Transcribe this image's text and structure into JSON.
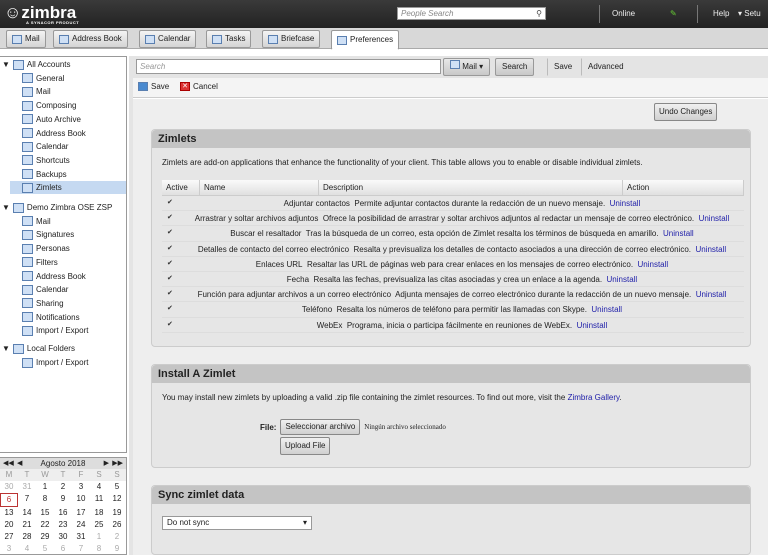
{
  "header": {
    "logo": "zimbra",
    "logo_sub": "A SYNACOR PRODUCT",
    "people_search_placeholder": "People Search",
    "status": "Online",
    "help": "Help",
    "setup": "▾ Setu"
  },
  "app_tabs": [
    {
      "label": "Mail",
      "icon": "mail-icon"
    },
    {
      "label": "Address Book",
      "icon": "contact-icon"
    },
    {
      "label": "Calendar",
      "icon": "calendar-icon"
    },
    {
      "label": "Tasks",
      "icon": "tasks-icon"
    },
    {
      "label": "Briefcase",
      "icon": "briefcase-icon"
    },
    {
      "label": "Preferences",
      "icon": "gear-icon",
      "active": true
    }
  ],
  "sidebar": {
    "all_accounts": "All Accounts",
    "items": [
      "General",
      "Mail",
      "Composing",
      "Auto Archive",
      "Address Book",
      "Calendar",
      "Shortcuts",
      "Backups",
      "Zimlets"
    ],
    "selected": "Zimlets",
    "demo_account": "Demo Zimbra OSE ZSP",
    "demo_items": [
      "Mail",
      "Signatures",
      "Personas",
      "Filters",
      "Address Book",
      "Calendar",
      "Sharing",
      "Notifications",
      "Import / Export"
    ],
    "local_folders": "Local Folders",
    "local_items": [
      "Import / Export"
    ]
  },
  "calendar": {
    "month": "Agosto 2018",
    "dow": [
      "M",
      "T",
      "W",
      "T",
      "F",
      "S",
      "S"
    ],
    "weeks": [
      [
        "30",
        "31",
        "1",
        "2",
        "3",
        "4",
        "5"
      ],
      [
        "6",
        "7",
        "8",
        "9",
        "10",
        "11",
        "12"
      ],
      [
        "13",
        "14",
        "15",
        "16",
        "17",
        "18",
        "19"
      ],
      [
        "20",
        "21",
        "22",
        "23",
        "24",
        "25",
        "26"
      ],
      [
        "27",
        "28",
        "29",
        "30",
        "31",
        "1",
        "2"
      ],
      [
        "3",
        "4",
        "5",
        "6",
        "7",
        "8",
        "9"
      ]
    ],
    "today": "6"
  },
  "search": {
    "placeholder": "Search",
    "type": "Mail",
    "search": "Search",
    "save": "Save",
    "advanced": "Advanced"
  },
  "toolbar": {
    "save": "Save",
    "cancel": "Cancel",
    "undo": "Undo Changes"
  },
  "zimlets": {
    "title": "Zimlets",
    "intro": "Zimlets are add-on applications that enhance the functionality of your client. This table allows you to enable or disable individual zimlets.",
    "columns": [
      "Active",
      "Name",
      "Description",
      "Action"
    ],
    "rows": [
      {
        "name": "Adjuntar contactos",
        "desc": "Permite adjuntar contactos durante la redacción de un nuevo mensaje.",
        "action": "Uninstall"
      },
      {
        "name": "Arrastrar y soltar archivos adjuntos",
        "desc": "Ofrece la posibilidad de arrastrar y soltar archivos adjuntos al redactar un mensaje de correo electrónico.",
        "action": "Uninstall"
      },
      {
        "name": "Buscar el resaltador",
        "desc": "Tras la búsqueda de un correo, esta opción de Zimlet resalta los términos de búsqueda en amarillo.",
        "action": "Uninstall"
      },
      {
        "name": "Detalles de contacto del correo electrónico",
        "desc": "Resalta y previsualiza los detalles de contacto asociados a una dirección de correo electrónico.",
        "action": "Uninstall"
      },
      {
        "name": "Enlaces URL",
        "desc": "Resaltar las URL de páginas web para crear enlaces en los mensajes de correo electrónico.",
        "action": "Uninstall"
      },
      {
        "name": "Fecha",
        "desc": "Resalta las fechas, previsualiza las citas asociadas y crea un enlace a la agenda.",
        "action": "Uninstall"
      },
      {
        "name": "Función para adjuntar archivos a un correo electrónico",
        "desc": "Adjunta mensajes de correo electrónico durante la redacción de un nuevo mensaje.",
        "action": "Uninstall"
      },
      {
        "name": "Teléfono",
        "desc": "Resalta los números de teléfono para permitir las llamadas con Skype.",
        "action": "Uninstall"
      },
      {
        "name": "WebEx",
        "desc": "Programa, inicia o participa fácilmente en reuniones de WebEx.",
        "action": "Uninstall"
      }
    ]
  },
  "install": {
    "title": "Install A Zimlet",
    "text": "You may install new zimlets by uploading a valid .zip file containing the zimlet resources. To find out more, visit the",
    "link": "Zimbra Gallery",
    "file_label": "File:",
    "choose": "Seleccionar archivo",
    "no_file": "Ningún archivo seleccionado",
    "upload": "Upload File"
  },
  "sync": {
    "title": "Sync zimlet data",
    "value": "Do not sync"
  }
}
